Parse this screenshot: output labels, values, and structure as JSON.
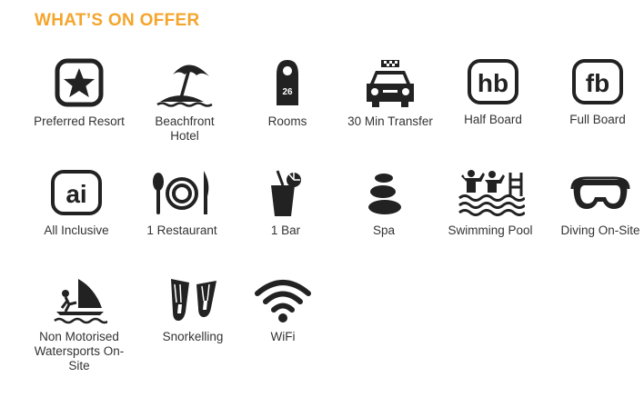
{
  "section": {
    "title": "WHAT’S ON OFFER"
  },
  "room_tag_number": "26",
  "icon_color": "#222222",
  "accent_color": "#f4a52c",
  "features": [
    {
      "icon": "star-badge-icon",
      "label": "Preferred Resort"
    },
    {
      "icon": "beach-umbrella-icon",
      "label": "Beachfront\nHotel"
    },
    {
      "icon": "door-hanger-icon",
      "label": "Rooms"
    },
    {
      "icon": "taxi-icon",
      "label": "30 Min Transfer"
    },
    {
      "icon": "half-board-icon",
      "label": "Half Board"
    },
    {
      "icon": "full-board-icon",
      "label": "Full Board"
    },
    {
      "icon": "all-inclusive-icon",
      "label": "All Inclusive"
    },
    {
      "icon": "restaurant-icon",
      "label": "1 Restaurant"
    },
    {
      "icon": "cocktail-icon",
      "label": "1 Bar"
    },
    {
      "icon": "spa-stones-icon",
      "label": "Spa"
    },
    {
      "icon": "swimming-pool-icon",
      "label": "Swimming Pool"
    },
    {
      "icon": "diving-mask-icon",
      "label": "Diving On-Site"
    },
    {
      "icon": "windsurf-icon",
      "label": "Non Motorised\nWatersports On-Site"
    },
    {
      "icon": "snorkel-fins-icon",
      "label": "Snorkelling"
    },
    {
      "icon": "wifi-icon",
      "label": "WiFi"
    }
  ]
}
